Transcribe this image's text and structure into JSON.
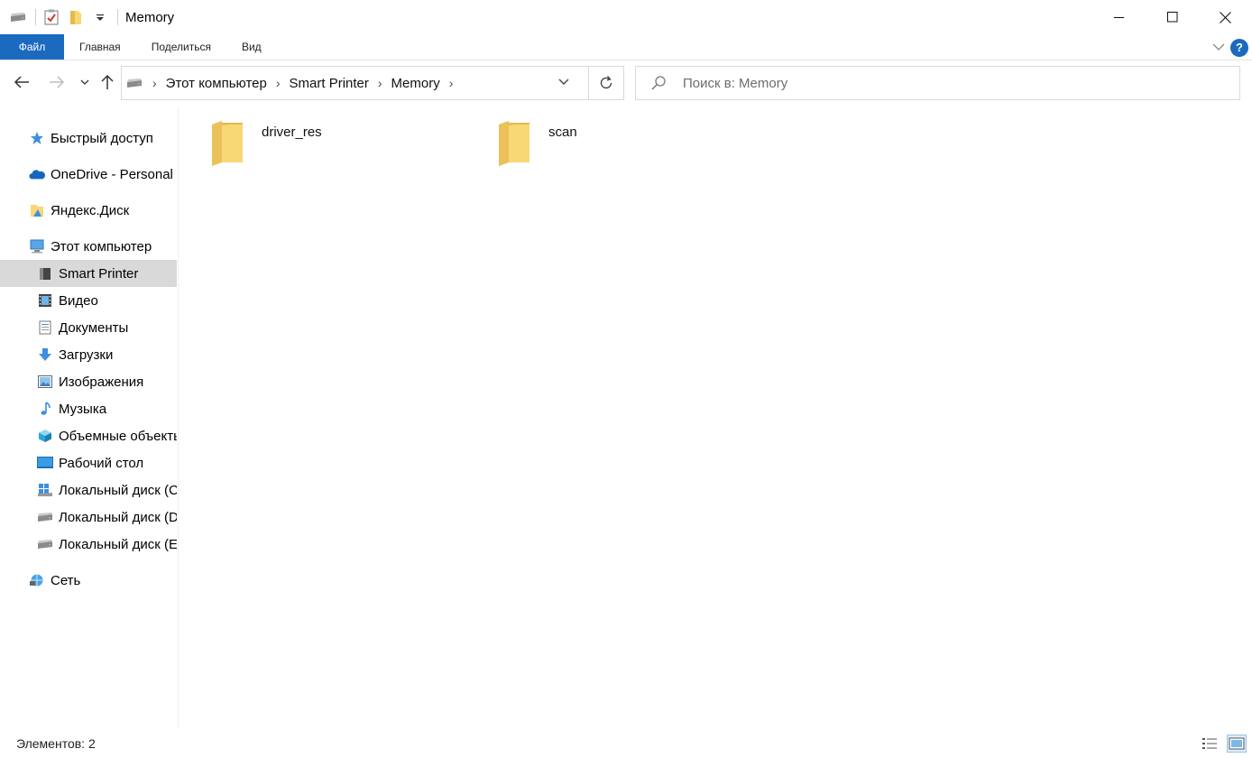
{
  "window": {
    "title": "Memory"
  },
  "ribbon": {
    "tabs": [
      "Файл",
      "Главная",
      "Поделиться",
      "Вид"
    ],
    "help_label": "?"
  },
  "address": {
    "crumbs": [
      "Этот компьютер",
      "Smart Printer",
      "Memory"
    ]
  },
  "search": {
    "placeholder": "Поиск в: Memory"
  },
  "sidebar": {
    "items": [
      {
        "label": "Быстрый доступ",
        "icon": "star-icon"
      },
      {
        "label": "OneDrive - Personal",
        "icon": "cloud-icon"
      },
      {
        "label": "Яндекс.Диск",
        "icon": "yandex-disk-icon"
      },
      {
        "label": "Этот компьютер",
        "icon": "computer-icon"
      },
      {
        "label": "Smart Printer",
        "icon": "drive-icon",
        "selected": true
      },
      {
        "label": "Видео",
        "icon": "video-icon"
      },
      {
        "label": "Документы",
        "icon": "documents-icon"
      },
      {
        "label": "Загрузки",
        "icon": "download-icon"
      },
      {
        "label": "Изображения",
        "icon": "pictures-icon"
      },
      {
        "label": "Музыка",
        "icon": "music-icon"
      },
      {
        "label": "Объемные объекты",
        "icon": "3d-objects-icon"
      },
      {
        "label": "Рабочий стол",
        "icon": "desktop-icon"
      },
      {
        "label": "Локальный диск (C:)",
        "icon": "windows-drive-icon"
      },
      {
        "label": "Локальный диск (D:)",
        "icon": "hdd-icon"
      },
      {
        "label": "Локальный диск (E:)",
        "icon": "hdd-icon"
      },
      {
        "label": "Сеть",
        "icon": "network-icon"
      }
    ]
  },
  "content": {
    "folders": [
      {
        "name": "driver_res",
        "icon": "folder-icon"
      },
      {
        "name": "scan",
        "icon": "folder-icon"
      }
    ]
  },
  "status": {
    "count_text": "Элементов: 2"
  },
  "colors": {
    "accent": "#1a6bbf",
    "selection": "#d9d9d9",
    "folder": "#f8d775"
  }
}
